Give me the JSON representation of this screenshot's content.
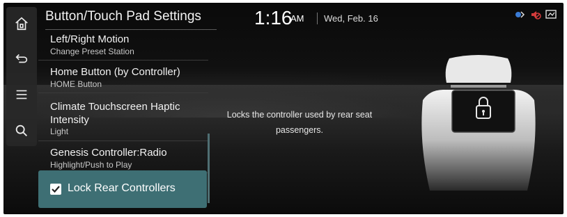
{
  "header": {
    "title": "Button/Touch Pad Settings",
    "time": "1:16",
    "ampm": "AM",
    "date": "Wed, Feb. 16"
  },
  "rail": {
    "icons": [
      "home-icon",
      "back-icon",
      "menu-icon",
      "search-icon"
    ]
  },
  "status_icons": [
    "bluetooth-phone-icon",
    "mute-icon",
    "phone-projection-icon"
  ],
  "list": {
    "items": [
      {
        "label": "Left/Right Motion",
        "value": "Change Preset Station"
      },
      {
        "label": "Home Button (by Controller)",
        "value": "HOME Button"
      },
      {
        "label": "Climate Touchscreen Haptic Intensity",
        "value": "Light"
      },
      {
        "label": "Genesis Controller:Radio",
        "value": "Highlight/Push to Play"
      }
    ],
    "selected": {
      "label": "Lock Rear Controllers",
      "checked": true
    }
  },
  "description": "Locks the controller used by rear seat passengers.",
  "colors": {
    "accent": "#3e6f74",
    "background": "#0e0e0e"
  }
}
